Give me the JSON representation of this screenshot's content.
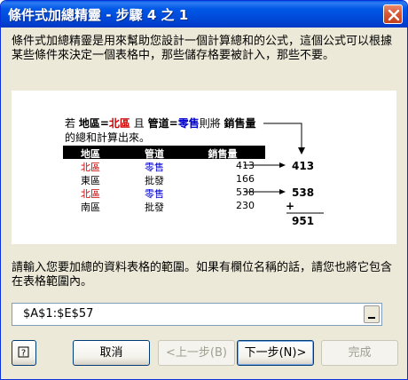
{
  "window": {
    "title": "條件式加總精靈 - 步驟 4 之 1"
  },
  "description": "條件式加總精靈是用來幫助您設計一個計算總和的公式，這個公式可以根據某些條件來決定一個表格中，那些儲存格要被計入，那些不要。",
  "example": {
    "cond_prefix": "若",
    "field1": "地區",
    "eq1": "=",
    "value1": "北區",
    "and": "且",
    "field2": "管道",
    "eq2": "=",
    "value2": "零售",
    "then": "則將",
    "field3": "銷售量",
    "cond_line2": "的總和計算出來。",
    "table": {
      "headers": [
        "地區",
        "管道",
        "銷售量"
      ],
      "rows": [
        {
          "region": "北區",
          "channel": "零售",
          "sales": "413"
        },
        {
          "region": "東區",
          "channel": "批發",
          "sales": "166"
        },
        {
          "region": "北區",
          "channel": "零售",
          "sales": "538"
        },
        {
          "region": "南區",
          "channel": "批發",
          "sales": "230"
        }
      ]
    },
    "result1": "413",
    "result2": "538",
    "plus": "+",
    "total": "951"
  },
  "prompt": "請輸入您要加總的資料表格的範圍。如果有欄位名稱的話，請您也將它包含在表格範圍內。",
  "range_value": "$A$1:$E$57",
  "buttons": {
    "cancel": "取消",
    "back": "<上一步(B)",
    "next": "下一步(N)>",
    "finish": "完成"
  },
  "colors": {
    "highlight_red": "#cc0000",
    "highlight_blue": "#0000cc",
    "titlebar": "#0058e6"
  }
}
